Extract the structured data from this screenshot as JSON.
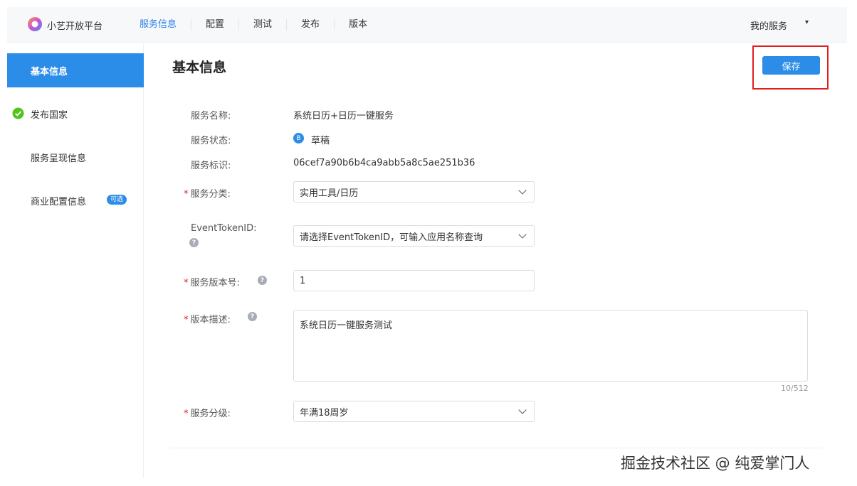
{
  "header": {
    "brand": "小艺开放平台",
    "nav": [
      "服务信息",
      "配置",
      "测试",
      "发布",
      "版本"
    ],
    "active_nav": "服务信息",
    "account_menu": "我的服务",
    "account_caret": "▾"
  },
  "sidebar": {
    "items": [
      {
        "label": "基本信息",
        "active": true
      },
      {
        "label": "发布国家",
        "completed": true
      },
      {
        "label": "服务呈现信息"
      },
      {
        "label": "商业配置信息",
        "badge": "可选"
      }
    ]
  },
  "page": {
    "title": "基本信息",
    "save_label": "保存"
  },
  "form": {
    "service_name": {
      "label": "服务名称:",
      "value": "系统日历+日历一键服务"
    },
    "service_status": {
      "label": "服务状态:",
      "value": "草稿",
      "icon_glyph": "B"
    },
    "service_id": {
      "label": "服务标识:",
      "value": "06cef7a90b6b4ca9abb5a8c5ae251b36"
    },
    "category": {
      "required_mark": "*",
      "label": "服务分类:",
      "value": "实用工具/日历"
    },
    "event_token": {
      "label": "EventTokenID:",
      "placeholder": "请选择EventTokenID，可输入应用名称查询"
    },
    "version": {
      "required_mark": "*",
      "label": "服务版本号:",
      "value": "1"
    },
    "description": {
      "required_mark": "*",
      "label": "版本描述:",
      "value": "系统日历一键服务测试",
      "counter": "10/512"
    },
    "grade": {
      "required_mark": "*",
      "label": "服务分级:",
      "value": "年满18周岁"
    },
    "help_glyph": "?"
  },
  "watermark": "掘金技术社区 @ 纯爱掌门人",
  "colors": {
    "accent": "#2b8de8",
    "highlight": "#e02020",
    "success": "#52c41a"
  }
}
